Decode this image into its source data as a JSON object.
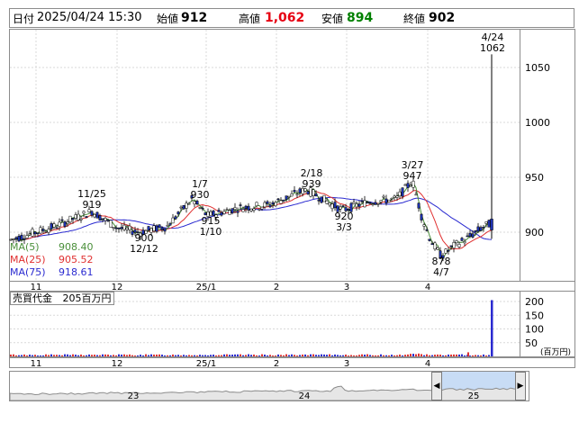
{
  "infobar": {
    "date_label": "日付",
    "date_value": "2025/04/24 15:30",
    "open_label": "始値",
    "open_value": "912",
    "high_label": "高値",
    "high_value": "1,062",
    "low_label": "安値",
    "low_value": "894",
    "close_label": "終値",
    "close_value": "902"
  },
  "colors": {
    "high": "#e60012",
    "low": "#008000",
    "candle_up": "#ffffff",
    "candle_down": "#1e32b4",
    "ma5": "#4a8f3a",
    "ma25": "#e03030",
    "ma75": "#2a2ad0"
  },
  "legend": {
    "ma5": "MA(5)",
    "ma5_value": "908.40",
    "ma25": "MA(25)",
    "ma25_value": "905.52",
    "ma75": "MA(75)",
    "ma75_value": "918.61"
  },
  "volume_legend": {
    "label": "売買代金",
    "value": "205百万円",
    "unit": "(百万円)"
  },
  "chart_data": {
    "type": "candlestick",
    "price_ticks": [
      "1050",
      "1000",
      "950",
      "900"
    ],
    "volume_ticks": [
      "200",
      "150",
      "100",
      "50"
    ],
    "x_month_labels": [
      "11",
      "12",
      "25/1",
      "2",
      "3",
      "4"
    ],
    "navigator_labels": [
      "23",
      "24",
      "25"
    ],
    "annotations": [
      {
        "date": "11/25",
        "value": "919"
      },
      {
        "date": "12/12",
        "value": "900"
      },
      {
        "date": "1/7",
        "value": "930"
      },
      {
        "date": "1/10",
        "value": "915"
      },
      {
        "date": "2/18",
        "value": "939"
      },
      {
        "date": "3/3",
        "value": "920"
      },
      {
        "date": "3/27",
        "value": "947"
      },
      {
        "date": "4/7",
        "value": "878"
      },
      {
        "date": "4/24",
        "value": "1062"
      }
    ],
    "ylim": [
      860,
      1080
    ],
    "volume_ylim": [
      0,
      220
    ],
    "last_volume": 205
  }
}
